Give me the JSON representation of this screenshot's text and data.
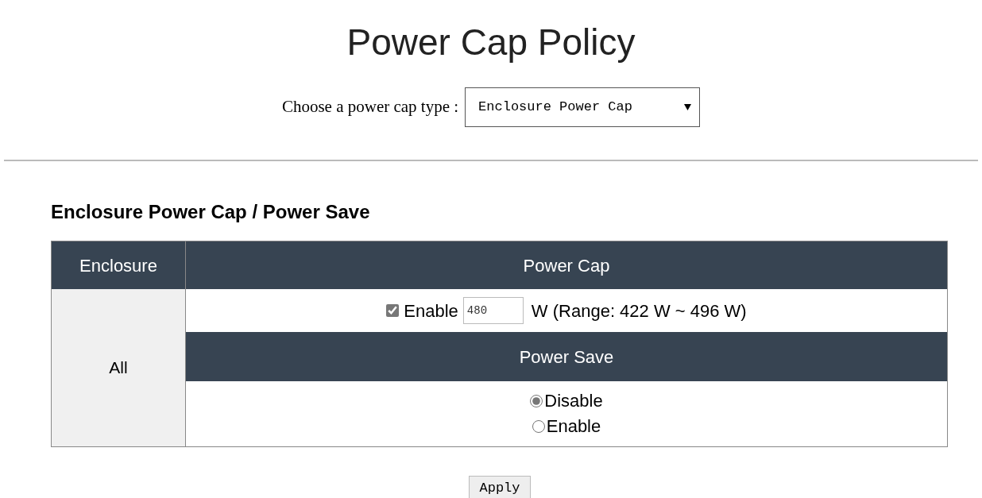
{
  "title": "Power Cap Policy",
  "cap_type": {
    "label": "Choose a power cap type :",
    "value": "Enclosure Power Cap"
  },
  "section_heading": "Enclosure Power Cap / Power Save",
  "table": {
    "columns": [
      "Enclosure",
      "Power Cap"
    ],
    "enclosure": "All",
    "power_cap": {
      "enable_label": "Enable",
      "checked": true,
      "value": "480",
      "range_text": "W (Range: 422 W ~ 496 W)"
    },
    "power_save": {
      "heading": "Power Save",
      "options": [
        {
          "label": "Disable",
          "selected": true
        },
        {
          "label": "Enable",
          "selected": false
        }
      ]
    }
  },
  "apply_button": "Apply"
}
